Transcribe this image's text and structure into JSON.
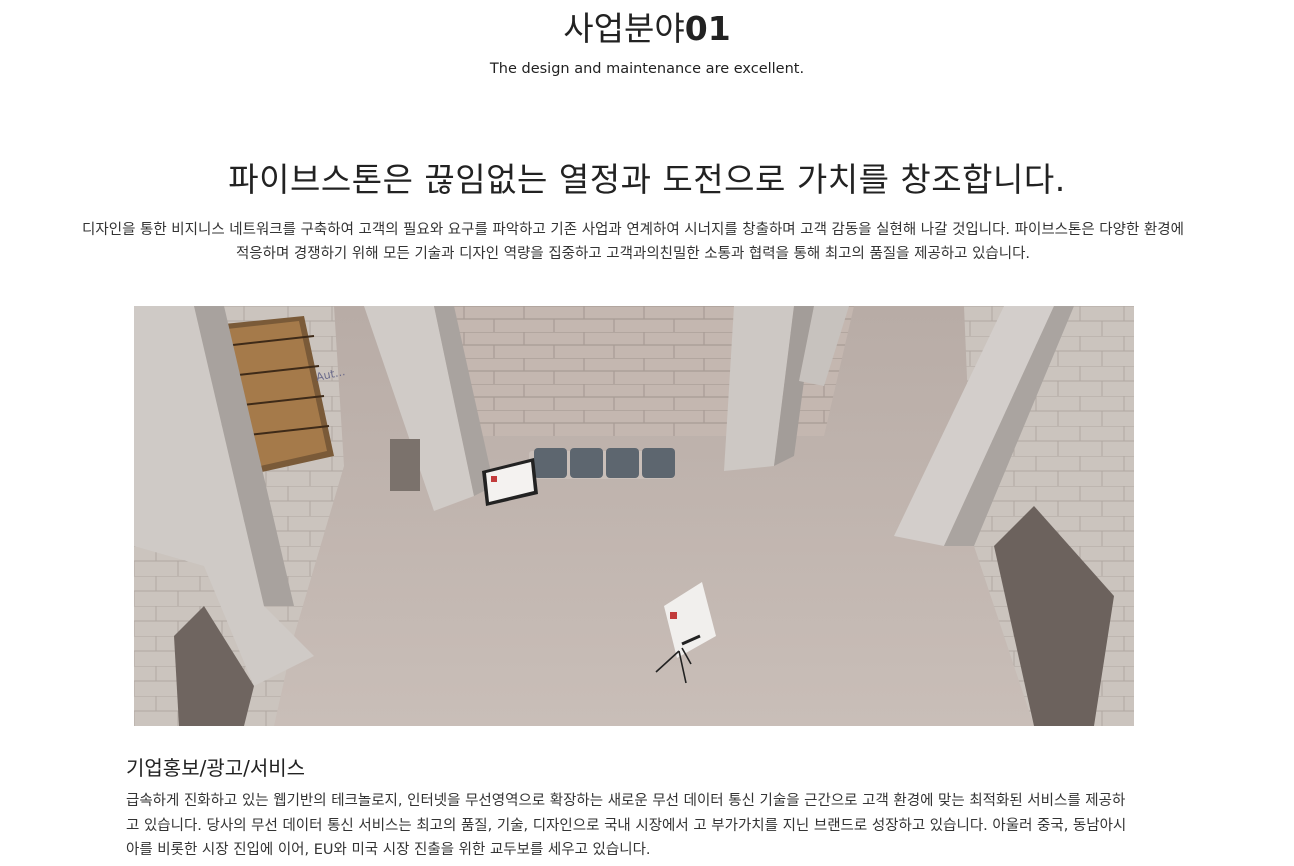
{
  "header": {
    "title_main": "사업분야",
    "title_num": "01",
    "subtitle": "The design and maintenance are excellent."
  },
  "intro": {
    "headline": "파이브스톤은 끊임없는 열정과 도전으로 가치를 창조합니다.",
    "paragraph": "디자인을 통한 비지니스 네트워크를 구축하여 고객의 필요와 요구를 파악하고 기존 사업과 연계하여 시너지를 창출하며 고객 감동을 실현해 나갈 것입니다. 파이브스톤은 다양한 환경에 적응하며 경쟁하기 위해 모든 기술과 디자인 역량을 집중하고 고객과의친밀한 소통과 협력을 통해 최고의 품질을 제공하고 있습니다."
  },
  "hero": {
    "image": "atrium-photo",
    "wall_sign": "Aut..."
  },
  "section": {
    "title": "기업홍보/광고/서비스",
    "body": "급속하게 진화하고 있는 웹기반의 테크놀로지, 인터넷을 무선영역으로 확장하는 새로운 무선 데이터 통신 기술을 근간으로 고객 환경에 맞는 최적화된 서비스를 제공하고 있습니다. 당사의 무선 데이터 통신 서비스는 최고의 품질, 기술, 디자인으로 국내 시장에서 고 부가가치를 지닌 브랜드로 성장하고 있습니다. 아울러 중국, 동남아시아를 비롯한 시장 진입에 이어, EU와 미국 시장 진출을 위한 교두보를 세우고 있습니다."
  }
}
